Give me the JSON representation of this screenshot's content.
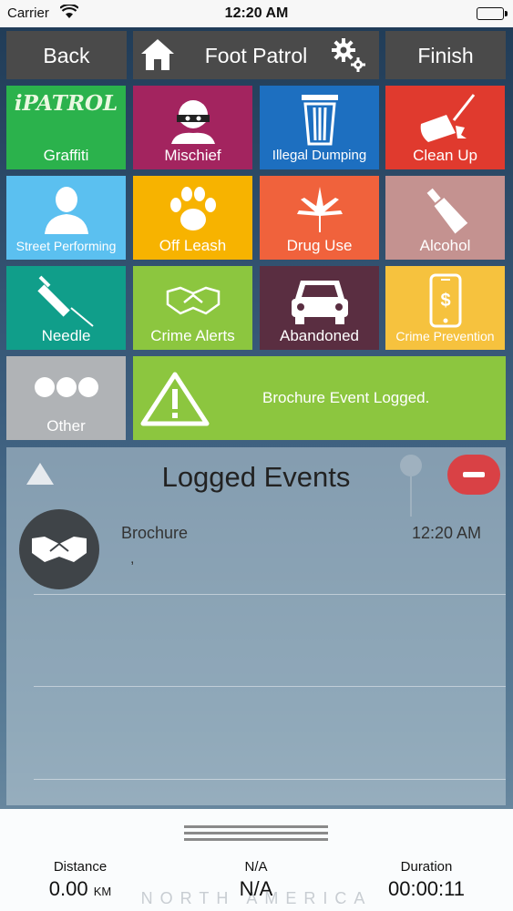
{
  "status_bar": {
    "carrier": "Carrier",
    "time": "12:20 AM"
  },
  "nav": {
    "back_label": "Back",
    "title": "Foot Patrol",
    "finish_label": "Finish"
  },
  "tiles": [
    {
      "label": "Graffiti",
      "color": "#2bb24c",
      "icon": "graffiti-logo",
      "logo_text": "iPATROL"
    },
    {
      "label": "Mischief",
      "color": "#a3245f",
      "icon": "masked-person-icon"
    },
    {
      "label": "Illegal Dumping",
      "color": "#1d6fc0",
      "icon": "trash-can-icon"
    },
    {
      "label": "Clean Up",
      "color": "#e03a2e",
      "icon": "broom-icon"
    },
    {
      "label": "Street Performing",
      "color": "#5bc0f0",
      "icon": "person-icon"
    },
    {
      "label": "Off Leash",
      "color": "#f7b300",
      "icon": "paw-icon"
    },
    {
      "label": "Drug Use",
      "color": "#f0623c",
      "icon": "leaf-icon"
    },
    {
      "label": "Alcohol",
      "color": "#c49290",
      "icon": "bottle-icon"
    },
    {
      "label": "Needle",
      "color": "#109e8a",
      "icon": "syringe-icon"
    },
    {
      "label": "Crime Alerts",
      "color": "#8cc63f",
      "icon": "handshake-icon"
    },
    {
      "label": "Abandoned",
      "color": "#5a2e41",
      "icon": "car-icon"
    },
    {
      "label": "Crime Prevention",
      "color": "#f6c23e",
      "icon": "phone-dollar-icon"
    },
    {
      "label": "Other",
      "color": "#b0b3b6",
      "icon": "dots-icon"
    }
  ],
  "banner": {
    "message": "Brochure Event Logged.",
    "color": "#8cc63f"
  },
  "logged_events": {
    "title": "Logged Events",
    "events": [
      {
        "name": "Brochure",
        "time": "12:20 AM",
        "detail": ","
      }
    ]
  },
  "stats": {
    "distance_label": "Distance",
    "distance_value": "0.00",
    "distance_unit": "KM",
    "middle_label": "N/A",
    "middle_value": "N/A",
    "duration_label": "Duration",
    "duration_value": "00:00:11"
  },
  "map_watermark": "NORTH AMERICA"
}
